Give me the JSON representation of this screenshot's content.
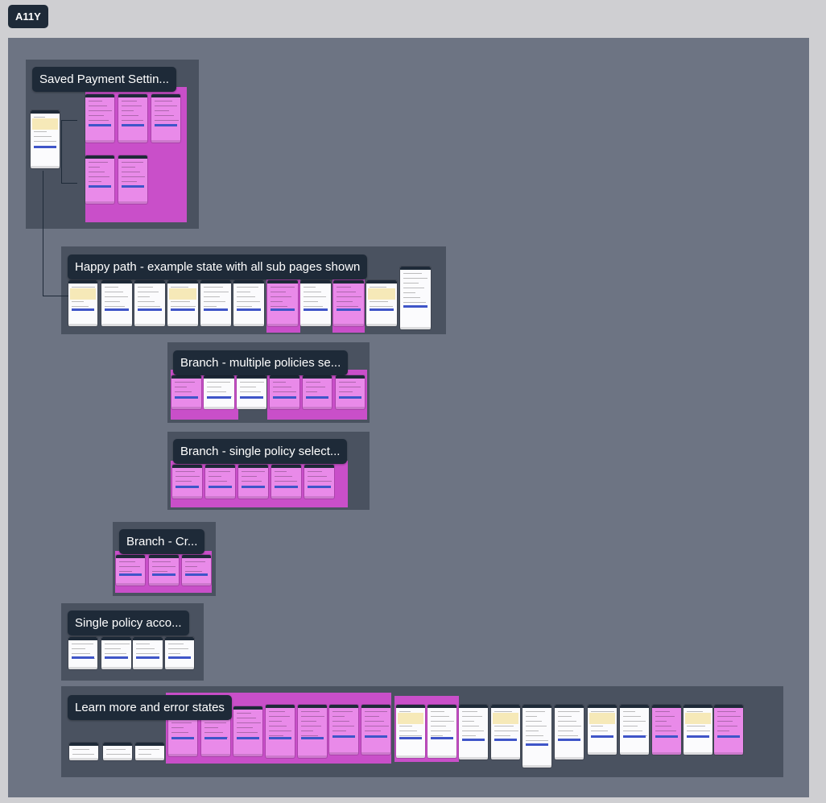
{
  "board": {
    "badge": "A11Y",
    "colors": {
      "canvas": "#6d7483",
      "section": "#4a5260",
      "label_bg": "#1e2a38",
      "screen_pink": "#e98ae9",
      "screen_white": "#fbfbfd",
      "accent_button": "#3f55c8"
    }
  },
  "sections": [
    {
      "title": "Saved Payment Settin..."
    },
    {
      "title": "Happy path - example state with all sub pages shown"
    },
    {
      "title": "Branch - multiple policies se..."
    },
    {
      "title": "Branch - single policy select..."
    },
    {
      "title": "Branch - Cr..."
    },
    {
      "title": "Single policy acco..."
    },
    {
      "title": "Learn more and error states"
    }
  ]
}
